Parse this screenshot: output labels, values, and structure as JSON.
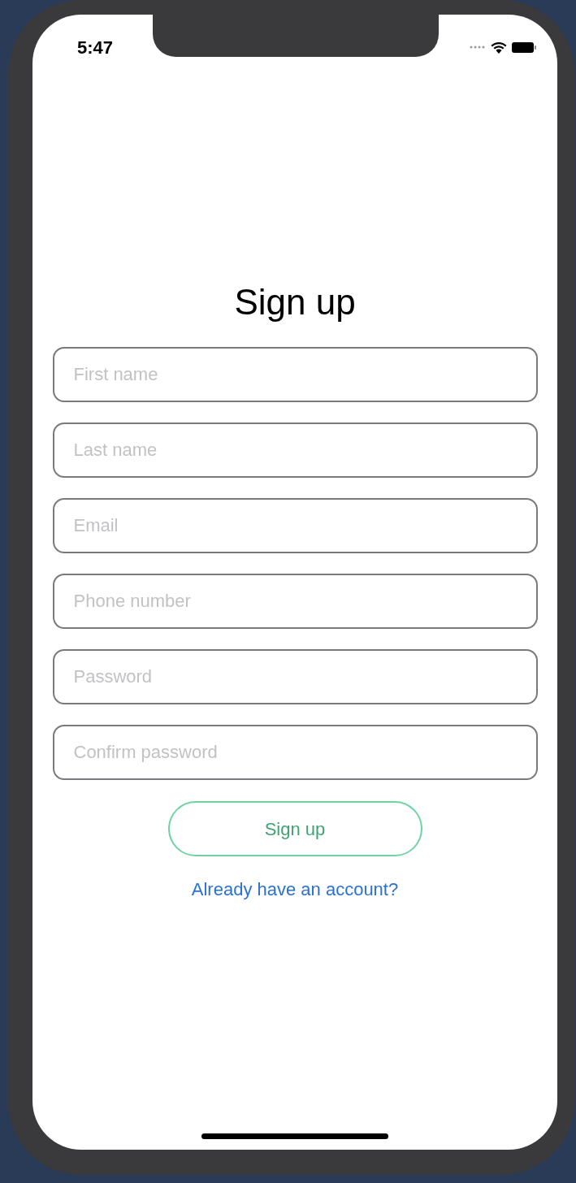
{
  "status_bar": {
    "time": "5:47"
  },
  "title": "Sign up",
  "fields": [
    {
      "placeholder": "First name"
    },
    {
      "placeholder": "Last name"
    },
    {
      "placeholder": "Email"
    },
    {
      "placeholder": "Phone number"
    },
    {
      "placeholder": "Password"
    },
    {
      "placeholder": "Confirm password"
    }
  ],
  "submit_button": "Sign up",
  "login_link": "Already have an account?"
}
